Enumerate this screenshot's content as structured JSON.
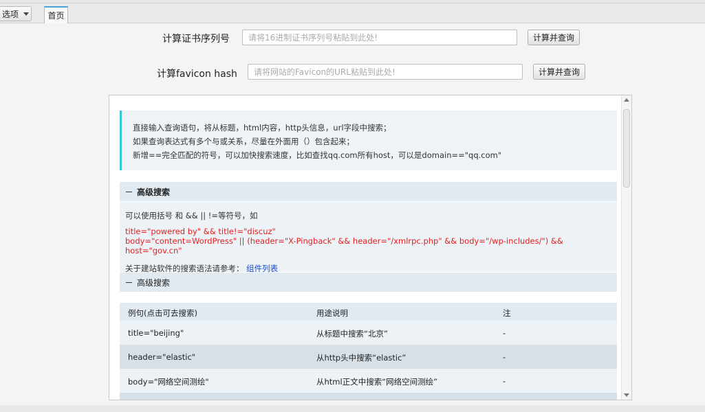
{
  "toolbar": {
    "menu_label": "选项",
    "tab_home": "首页"
  },
  "cert": {
    "label": "计算证书序列号",
    "placeholder": "请将16进制证书序列号粘贴到此处!",
    "button": "计算并查询"
  },
  "favicon": {
    "label": "计算favicon hash",
    "placeholder": "请将网站的Favicon的URL粘贴到此处!",
    "button": "计算并查询"
  },
  "notice": {
    "line1": "直接输入查询语句，将从标题，html内容，http头信息，url字段中搜索；",
    "line2": "如果查询表达式有多个与或关系，尽量在外面用（）包含起来；",
    "line3": "新增==完全匹配的符号，可以加快搜索速度，比如查找qq.com所有host，可以是domain==\"qq.com\""
  },
  "advanced": {
    "header": "高级搜索",
    "intro": "可以使用括号 和 && || !=等符号，如",
    "example1": "title=\"powered by\" && title!=\"discuz\"",
    "example2": "body=\"content=WordPress\" || (header=\"X-Pingback\" && header=\"/xmlrpc.php\" && body=\"/wp-includes/\") && host=\"gov.cn\"",
    "ref_prefix": "关于建站软件的搜索语法请参考：",
    "ref_link": "组件列表",
    "sub_header": "高级搜索"
  },
  "table": {
    "headers": [
      "例句(点击可去搜索)",
      "用途说明",
      "注"
    ],
    "rows": [
      [
        "title=\"beijing\"",
        "从标题中搜索“北京”",
        "-"
      ],
      [
        "header=\"elastic\"",
        "从http头中搜索“elastic”",
        "-"
      ],
      [
        "body=\"网络空间测绘\"",
        "从html正文中搜索“网络空间测绘”",
        "-"
      ]
    ]
  }
}
